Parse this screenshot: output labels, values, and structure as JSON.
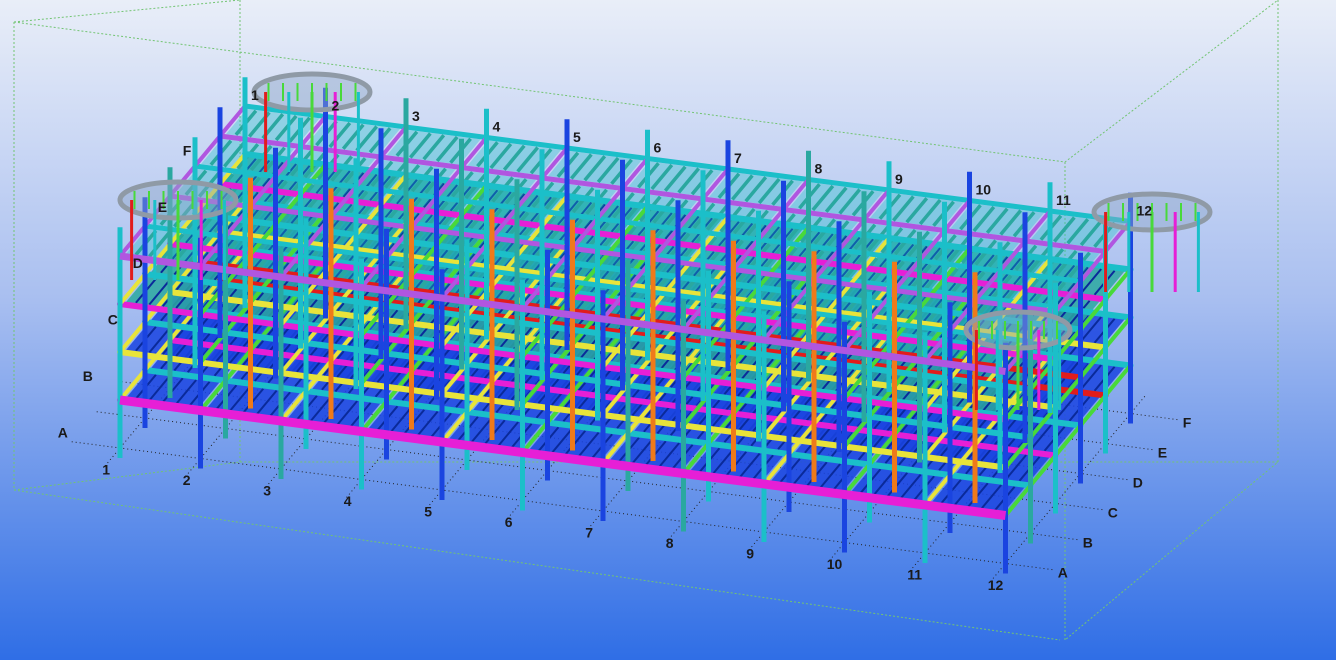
{
  "viewport": {
    "background_top": "#e9eef8",
    "background_bottom": "#2f6ee6",
    "work_area_color": "#72c472"
  },
  "grid_labels": {
    "front_numbers": [
      "1",
      "2",
      "3",
      "4",
      "5",
      "6",
      "7",
      "8",
      "9",
      "10",
      "11",
      "12"
    ],
    "back_numbers": [
      "1",
      "2",
      "3",
      "4",
      "5",
      "6",
      "7",
      "8",
      "9",
      "10",
      "11",
      "12"
    ],
    "left_letters": [
      "A",
      "B",
      "C",
      "D",
      "E",
      "F"
    ],
    "right_letters": [
      "A",
      "B",
      "C",
      "D",
      "E",
      "F"
    ]
  },
  "member_colors": {
    "magenta": "#e61fd6",
    "cyan": "#1bbfc9",
    "blue": "#1a44e0",
    "yellow": "#e8e43a",
    "orange": "#ef7a1a",
    "red": "#e11c1c",
    "green": "#48d93a",
    "violet": "#b056e0",
    "grey": "#8f9aa6",
    "teal": "#2aa8a0"
  }
}
